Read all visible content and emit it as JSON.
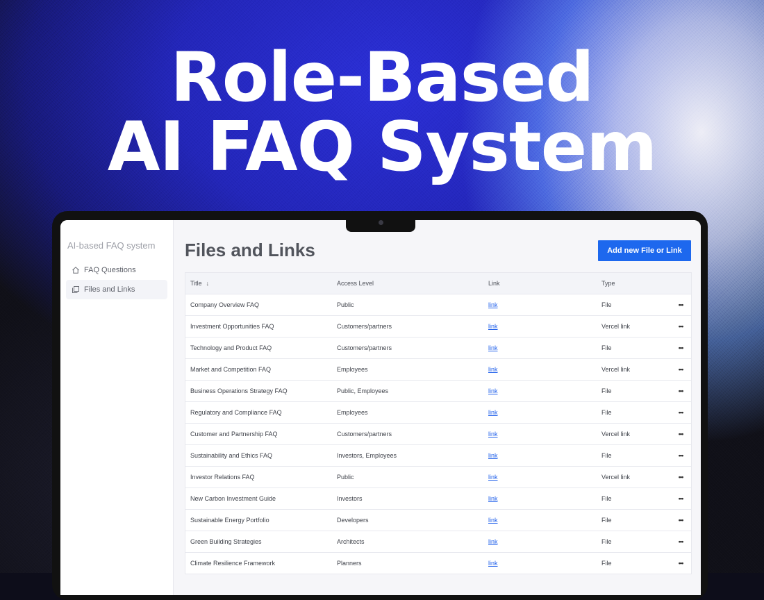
{
  "hero": {
    "line1": "Role-Based",
    "line2": "AI FAQ System"
  },
  "app": {
    "title": "AI-based FAQ system"
  },
  "sidebar": {
    "items": [
      {
        "label": "FAQ Questions",
        "icon": "home-icon",
        "active": false
      },
      {
        "label": "Files and Links",
        "icon": "files-icon",
        "active": true
      }
    ]
  },
  "main": {
    "title": "Files and Links",
    "add_button": "Add new File or Link"
  },
  "table": {
    "headers": {
      "title": "Title",
      "access": "Access Level",
      "link": "Link",
      "type": "Type"
    },
    "sort_icon": "arrow-down-icon",
    "rows": [
      {
        "title": "Company Overview FAQ",
        "access": "Public",
        "link": "link",
        "type": "File",
        "more": "•••"
      },
      {
        "title": "Investment Opportunities FAQ",
        "access": "Customers/partners",
        "link": "link",
        "type": "Vercel link",
        "more": "•••"
      },
      {
        "title": "Technology and Product FAQ",
        "access": "Customers/partners",
        "link": "link",
        "type": "File",
        "more": "•••"
      },
      {
        "title": "Market and Competition FAQ",
        "access": "Employees",
        "link": "link",
        "type": "Vercel link",
        "more": "•••"
      },
      {
        "title": "Business Operations Strategy FAQ",
        "access": "Public, Employees",
        "link": "link",
        "type": "File",
        "more": "•••"
      },
      {
        "title": "Regulatory and Compliance FAQ",
        "access": "Employees",
        "link": "link",
        "type": "File",
        "more": "•••"
      },
      {
        "title": "Customer and Partnership FAQ",
        "access": "Customers/partners",
        "link": "link",
        "type": "Vercel link",
        "more": "•••"
      },
      {
        "title": "Sustainability and Ethics FAQ",
        "access": "Investors, Employees",
        "link": "link",
        "type": "File",
        "more": "•••"
      },
      {
        "title": "Investor Relations FAQ",
        "access": "Public",
        "link": "link",
        "type": "Vercel link",
        "more": "•••"
      },
      {
        "title": "New Carbon Investment Guide",
        "access": "Investors",
        "link": "link",
        "type": "File",
        "more": "•••"
      },
      {
        "title": "Sustainable Energy Portfolio",
        "access": "Developers",
        "link": "link",
        "type": "File",
        "more": "•••"
      },
      {
        "title": "Green Building Strategies",
        "access": "Architects",
        "link": "link",
        "type": "File",
        "more": "•••"
      },
      {
        "title": "Climate Resilience Framework",
        "access": "Planners",
        "link": "link",
        "type": "File",
        "more": "•••"
      }
    ]
  },
  "colors": {
    "accent": "#1d68ee",
    "link": "#2563eb"
  }
}
